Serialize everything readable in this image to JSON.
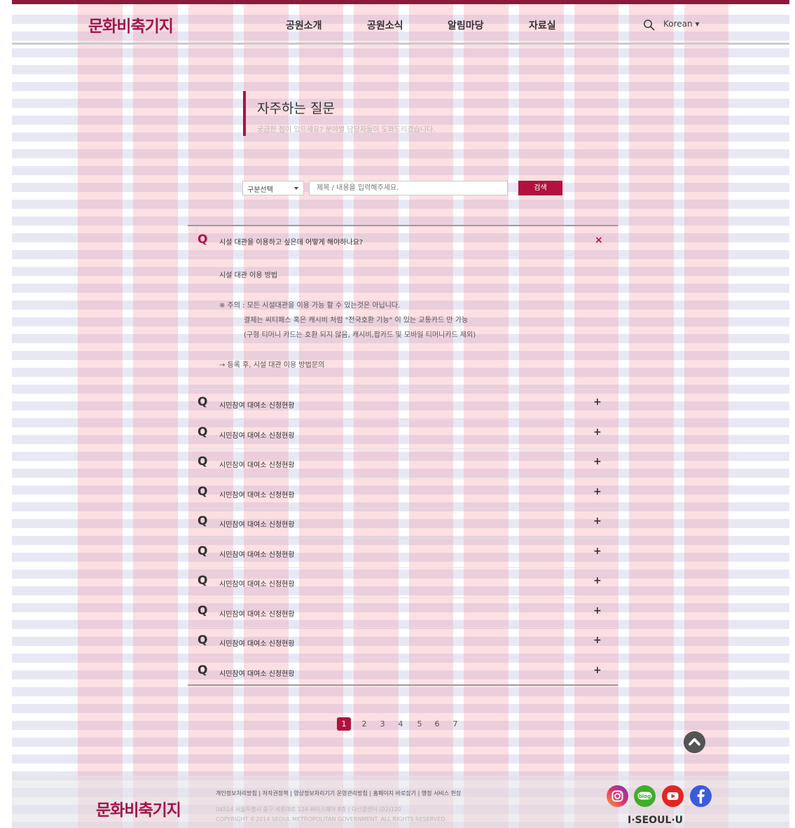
{
  "header": {
    "logo": "문화비축기지",
    "nav": [
      "공원소개",
      "공원소식",
      "알림마당",
      "자료실"
    ],
    "language": "Korean ▾"
  },
  "page": {
    "title": "자주하는 질문",
    "subtitle": "궁금한 점이 있으세요? 분야별 담당자들이 도와드리겠습니다."
  },
  "search": {
    "category": "구분선택",
    "placeholder": "제목 / 내용을 입력해주세요.",
    "button": "검색"
  },
  "faq": {
    "q_mark": "Q",
    "open_item": {
      "question": "시설 대관을 이용하고 싶은데 어떻게 해야하나요?",
      "close_symbol": "×",
      "answer_title": "시설 대관 이용 방법",
      "answer_lines": [
        "※ 주의 : 모든 시설대관을  이용 가능 할 수 있는것은 아닙니다.",
        "결제는 씨티패스 혹은 캐시비 처럼 \"전국호환 기능\" 이 있는 교통카드 만 가능",
        "(구형 티머니 카드는 호환 되지 않음, 캐시비,팝카드 및 모바일 티머니카드 제외)"
      ],
      "answer_link": "→ 등록 후, 시설 대관 이용 방법문의"
    },
    "items": [
      "시민참여 대여소 신청현황",
      "시민참여 대여소 신청현황",
      "시민참여 대여소 신청현황",
      "시민참여 대여소 신청현황",
      "시민참여 대여소 신청현황",
      "시민참여 대여소 신청현황",
      "시민참여 대여소 신청현황",
      "시민참여 대여소 신청현황",
      "시민참여 대여소 신청현황",
      "시민참여 대여소 신청현황"
    ],
    "expand_symbol": "+"
  },
  "pagination": {
    "pages": [
      "1",
      "2",
      "3",
      "4",
      "5",
      "6",
      "7"
    ],
    "active": "1"
  },
  "footer": {
    "logo": "문화비축기지",
    "links": "개인정보처리방침  |  저작권정책  |  영상정보처리기기 운영관리방침  |  홈페이지 바로잡기  |  행정 서비스 헌장",
    "address": "04514 서울특별시 중구 세종대로 124 씨티스퀘어 8층  |  다산콜센터 (02)120",
    "copyright": "COPYRIGHT ©2014 SEOUL METROPOLITAN GOVERNMENT. ALL RIGHTS RESERVED.",
    "social": [
      "instagram-icon",
      "blog-icon",
      "youtube-icon",
      "facebook-icon"
    ],
    "blog_badge": "blog",
    "brand": "I·SEOUL·U"
  },
  "colors": {
    "accent": "#b3113f",
    "brand": "#a3154a",
    "top_bar": "#8b1a3b"
  }
}
